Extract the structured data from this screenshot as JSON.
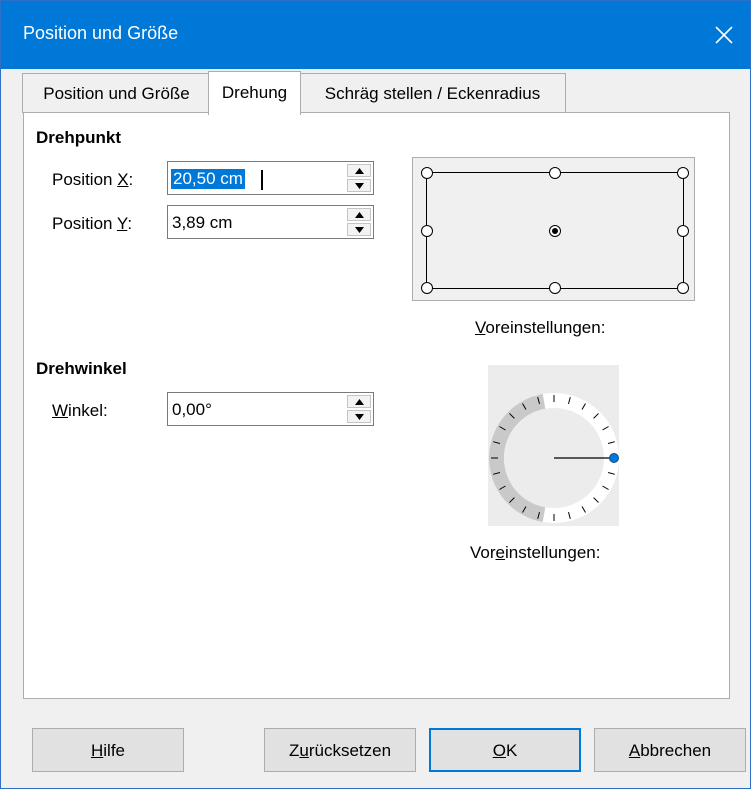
{
  "window": {
    "title": "Position und Größe"
  },
  "tabs": [
    {
      "label": "Position und Größe",
      "active": false
    },
    {
      "label": "Drehung",
      "active": true
    },
    {
      "label": "Schräg stellen / Eckenradius",
      "active": false
    }
  ],
  "pivot": {
    "heading": "Drehpunkt",
    "pos_x": {
      "pre": "Position ",
      "key": "X",
      "post": ":",
      "value": "20,50 cm"
    },
    "pos_y": {
      "pre": "Position ",
      "key": "Y",
      "post": ":",
      "value": "3,89 cm"
    },
    "presets_label": {
      "key": "V",
      "rest": "oreinstellungen:"
    }
  },
  "angle": {
    "heading": "Drehwinkel",
    "winkel": {
      "key": "W",
      "rest": "inkel:",
      "value": "0,00°"
    },
    "presets_label": {
      "pre": "Vor",
      "key": "e",
      "rest": "instellungen:"
    },
    "dial_value_degrees": 0
  },
  "buttons": {
    "help": {
      "key": "H",
      "rest": "ilfe"
    },
    "reset": {
      "pre": "Z",
      "key": "u",
      "rest": "rücksetzen"
    },
    "ok": {
      "key": "O",
      "rest": "K"
    },
    "cancel": {
      "key": "A",
      "rest": "bbrechen"
    }
  },
  "icons": [
    "close-icon",
    "arrow-up-icon",
    "arrow-down-icon"
  ],
  "colors": {
    "titlebar": "#0078d7",
    "selection": "#0078d7",
    "dial_knob": "#0078d7"
  }
}
